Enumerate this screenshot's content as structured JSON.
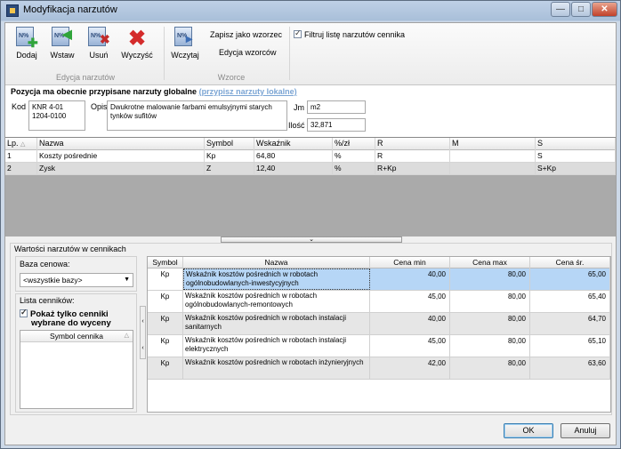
{
  "window": {
    "title": "Modyfikacja narzutów",
    "controls": {
      "minimize": "—",
      "maximize": "□",
      "close": "✕"
    }
  },
  "ribbon": {
    "groups": [
      {
        "label": "Edycja narzutów"
      },
      {
        "label": "Wzorce"
      }
    ],
    "buttons": {
      "dodaj": "Dodaj",
      "wstaw": "Wstaw",
      "usun": "Usuń",
      "wyczysc": "Wyczyść",
      "wczytaj": "Wczytaj"
    },
    "links": {
      "zapisz": "Zapisz jako wzorzec",
      "edycja": "Edycja wzorców"
    },
    "filter_label": "Filtruj listę narzutów cennika"
  },
  "assignment": {
    "title": "Pozycja ma obecnie przypisane narzuty globalne",
    "link": "(przypisz narzuty lokalne)",
    "kod_label": "Kod",
    "kod_line1": "KNR 4-01",
    "kod_line2": "1204-0100",
    "opis_label": "Opis",
    "opis_value": "Dwukrotne malowanie farbami emulsyjnymi starych tynków sufitów",
    "jm_label": "Jm",
    "jm_value": "m2",
    "ilosc_label": "Ilość",
    "ilosc_value": "32,871"
  },
  "surcharges": {
    "headers": [
      "Lp.",
      "Nazwa",
      "Symbol",
      "Wskaźnik",
      "%/zł",
      "R",
      "M",
      "S"
    ],
    "rows": [
      [
        "1",
        "Koszty pośrednie",
        "Kp",
        "64,80",
        "%",
        "R",
        "",
        "S"
      ],
      [
        "2",
        "Zysk",
        "Z",
        "12,40",
        "%",
        "R+Kp",
        "",
        "S+Kp"
      ]
    ]
  },
  "lower": {
    "title": "Wartości narzutów w cennikach",
    "baza_label": "Baza cenowa:",
    "baza_value": "<wszystkie bazy>",
    "lista_label": "Lista cenników:",
    "pokaz_label_1": "Pokaż tylko cenniki",
    "pokaz_label_2": "wybrane do wyceny",
    "symbol_header": "Symbol cennika"
  },
  "price_table": {
    "headers": [
      "Symbol",
      "Nazwa",
      "Cena min",
      "Cena max",
      "Cena śr."
    ],
    "rows": [
      [
        "Kp",
        "Wskaźnik kosztów pośrednich w robotach ogólnobudowlanych-inwestycyjnych",
        "40,00",
        "80,00",
        "65,00"
      ],
      [
        "Kp",
        "Wskaźnik kosztów pośrednich w robotach ogólnobudowlanych-remontowych",
        "45,00",
        "80,00",
        "65,40"
      ],
      [
        "Kp",
        "Wskaźnik kosztów pośrednich w robotach instalacji sanitarnych",
        "40,00",
        "80,00",
        "64,70"
      ],
      [
        "Kp",
        "Wskaźnik kosztów pośrednich w robotach instalacji elektrycznych",
        "45,00",
        "80,00",
        "65,10"
      ],
      [
        "Kp",
        "Wskaźnik kosztów pośrednich w robotach inżynieryjnych",
        "42,00",
        "80,00",
        "63,60"
      ]
    ]
  },
  "footer": {
    "ok": "OK",
    "cancel": "Anuluj"
  }
}
